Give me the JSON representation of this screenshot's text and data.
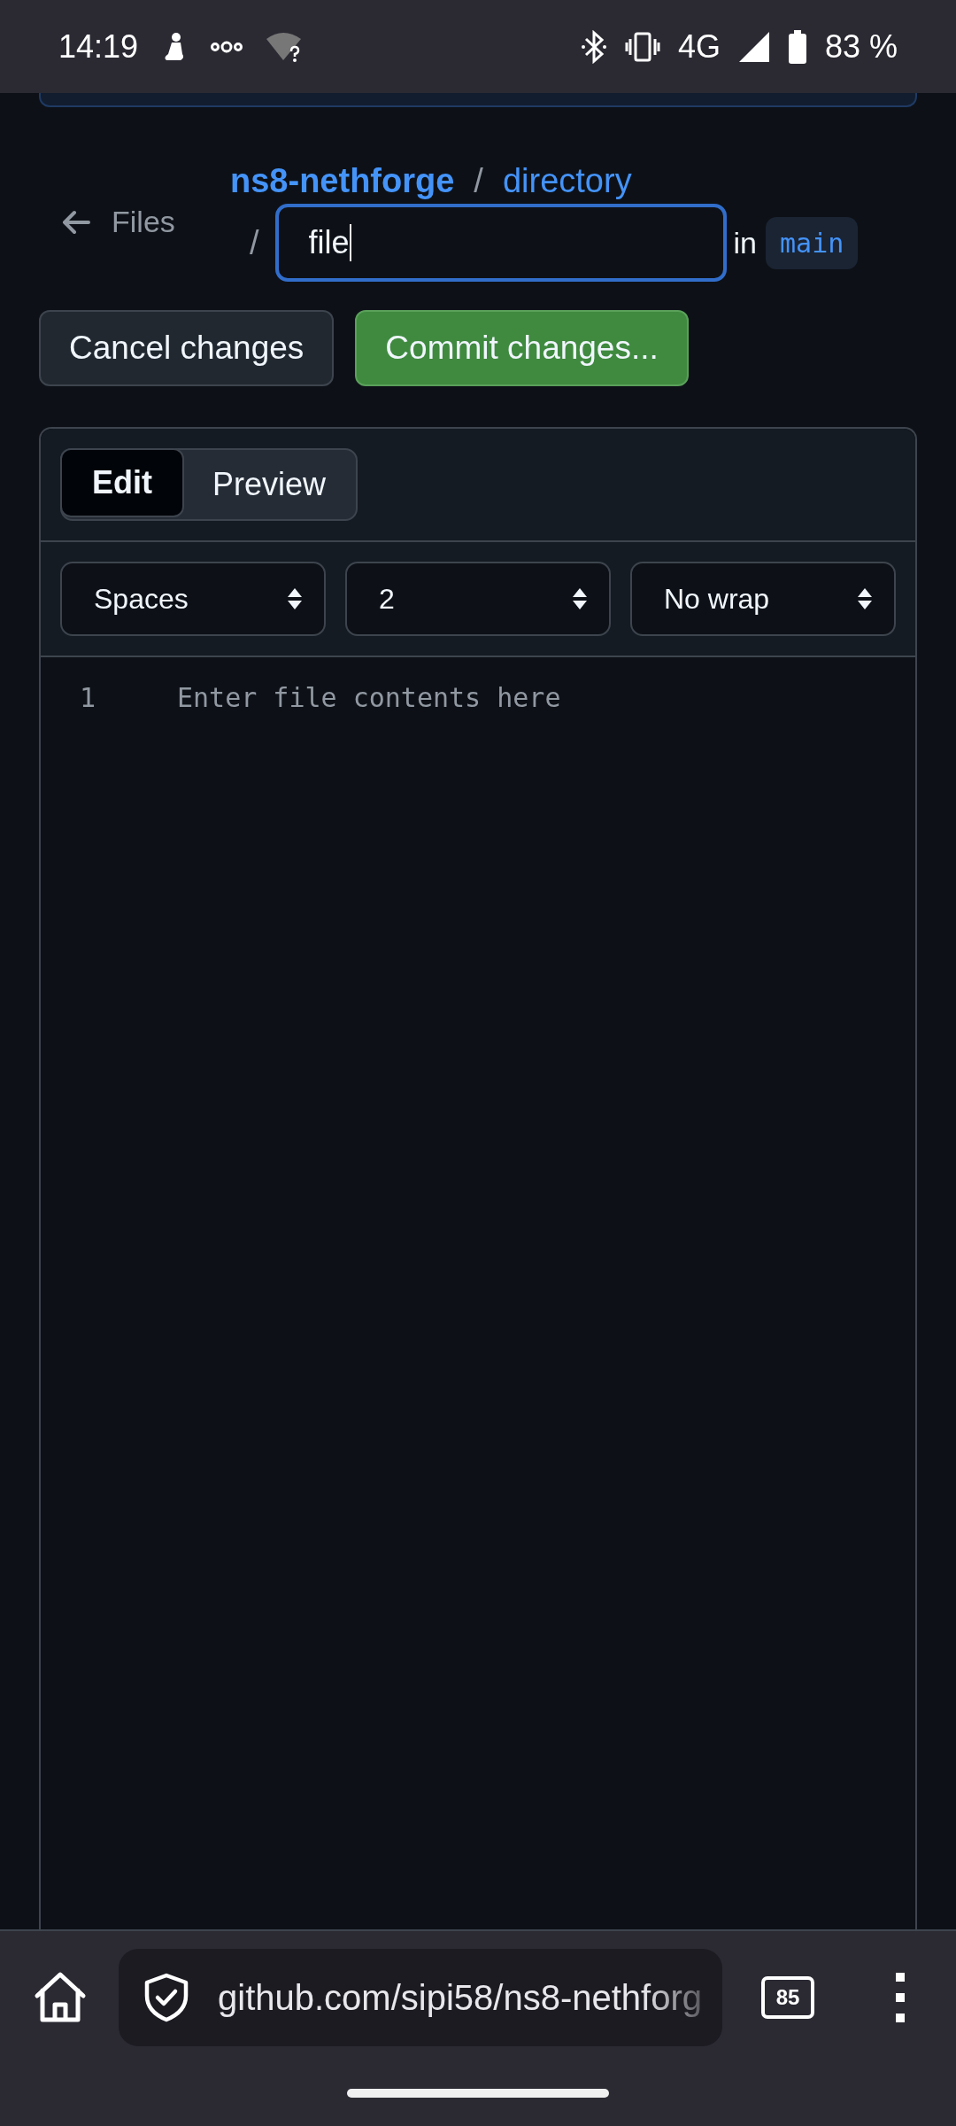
{
  "status_bar": {
    "time": "14:19",
    "network": "4G",
    "battery": "83 %"
  },
  "header": {
    "back_label": "Files",
    "breadcrumb": [
      "ns8-nethforge",
      "directory"
    ],
    "separator": "/",
    "filename": {
      "value": "file",
      "focused": true
    },
    "branch_prefix": "in",
    "branch": "main"
  },
  "buttons": [
    {
      "label": "Cancel changes",
      "kind": "default"
    },
    {
      "label": "Commit changes...",
      "kind": "primary"
    }
  ],
  "editor": {
    "tabs": [
      {
        "label": "Edit",
        "selected": true
      },
      {
        "label": "Preview",
        "selected": false
      }
    ],
    "settings": [
      {
        "value": "Spaces"
      },
      {
        "value": "2"
      },
      {
        "value": "No wrap"
      }
    ],
    "line_numbers": [
      "1"
    ],
    "placeholder": "Enter file contents here"
  },
  "browser_bar": {
    "url": "github.com/sipi58/ns8-nethforg",
    "tab_count": "85"
  }
}
